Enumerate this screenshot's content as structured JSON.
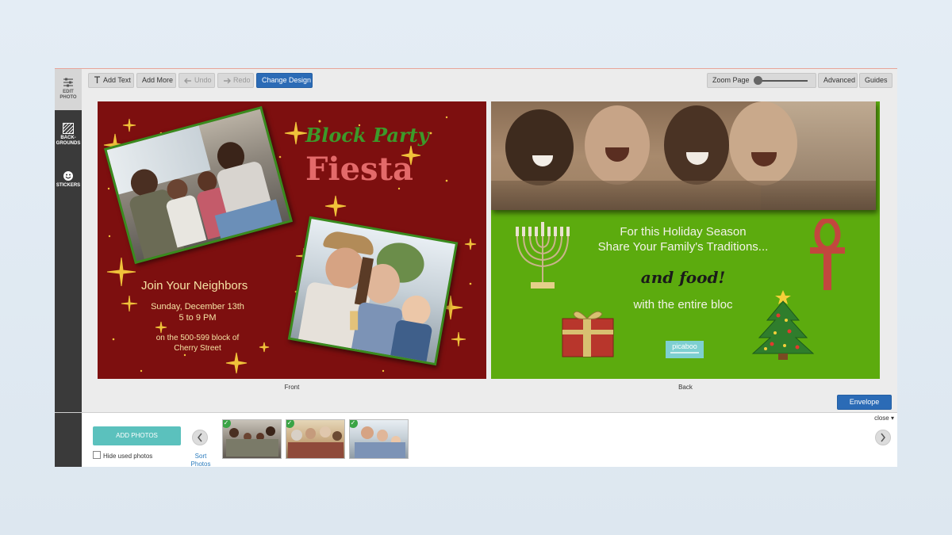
{
  "rail": {
    "items": [
      {
        "label": "EDIT\nPHOTO",
        "icon": "sliders-icon"
      },
      {
        "label": "BACK-\nGROUNDS",
        "icon": "background-pattern-icon"
      },
      {
        "label": "STICKERS",
        "icon": "smiley-icon"
      }
    ]
  },
  "toolbar": {
    "add_text": "Add Text",
    "add_more": "Add More",
    "undo": "Undo",
    "redo": "Redo",
    "change_design": "Change Design",
    "zoom_page": "Zoom Page",
    "zoom_level": 0.05,
    "advanced": "Advanced",
    "guides": "Guides"
  },
  "front": {
    "label": "Front",
    "title_line1": "Block Party",
    "title_line2": "Fiesta",
    "join": "Join Your Neighbors",
    "date": "Sunday, December 13th",
    "time": "5 to 9 PM",
    "location1": "on the 500-599 block of",
    "location2": "Cherry Street"
  },
  "back": {
    "label": "Back",
    "line1": "For this Holiday Season",
    "line2": "Share Your Family's Traditions...",
    "line3": "and food!",
    "line4": "with the entire bloc",
    "logo": "picaboo"
  },
  "envelope": "Envelope",
  "tray": {
    "add_photos": "ADD PHOTOS",
    "hide_used": "Hide used photos",
    "sort_photos": "Sort\nPhotos",
    "close": "close ▾"
  },
  "colors": {
    "front_bg": "#7d0f0f",
    "back_bg": "#5cab0e",
    "accent": "#2b6bb6",
    "add_photos": "#5bc1bd"
  }
}
